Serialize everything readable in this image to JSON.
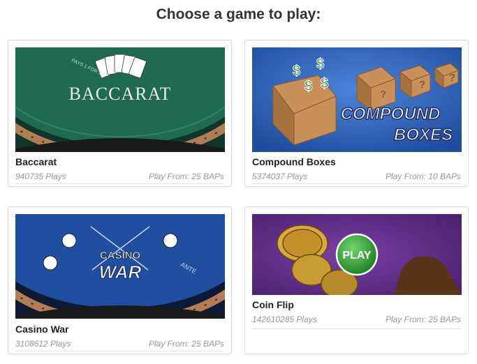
{
  "page": {
    "heading": "Choose a game to play:"
  },
  "games": [
    {
      "title": "Baccarat",
      "plays": "940735 Plays",
      "price": "Play From: 25 BAPs",
      "art_text": "BACCARAT",
      "art_sub": "PAYS 1 FOR 1"
    },
    {
      "title": "Compound Boxes",
      "plays": "5374037 Plays",
      "price": "Play From: 10 BAPs",
      "art_line1": "COMPOUND",
      "art_line2": "BOXES"
    },
    {
      "title": "Casino War",
      "plays": "3108612 Plays",
      "price": "Play From: 25 BAPs",
      "art_line1": "CASINO",
      "art_line2": "WAR",
      "art_ante": "ANTE"
    },
    {
      "title": "Coin Flip",
      "plays": "142610285 Plays",
      "price": "Play From: 25 BAPs",
      "art_button": "PLAY"
    }
  ],
  "colors": {
    "baccarat_felt": "#1f6b52",
    "compound_bg": "#2b5fb5",
    "war_felt": "#1f4fa0",
    "coin_bg": "#5b2d82",
    "play_button": "#2e9e34"
  }
}
